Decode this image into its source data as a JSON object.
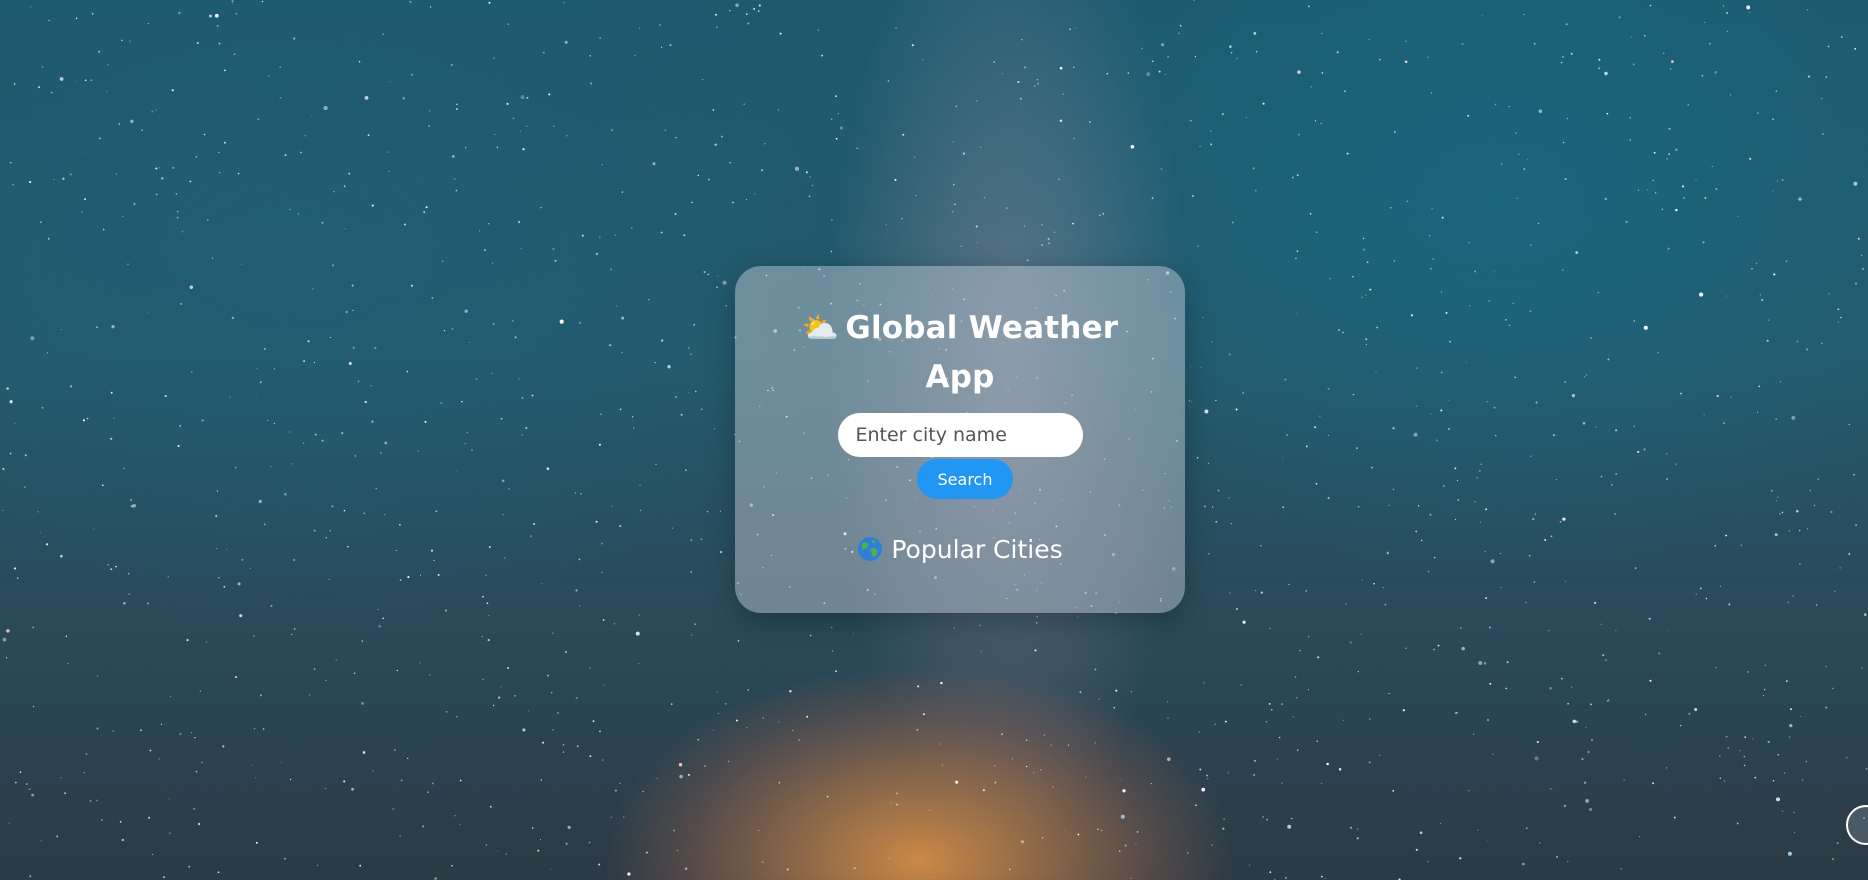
{
  "app": {
    "title": "Global Weather App",
    "title_icon": "cloud-sun-icon"
  },
  "search": {
    "placeholder": "Enter city name",
    "value": "",
    "button_label": "Search"
  },
  "popular": {
    "icon": "globe-icon",
    "label": "Popular Cities"
  },
  "colors": {
    "accent": "#2196f3",
    "card_background": "rgba(200,205,215,0.45)",
    "text": "#ffffff"
  }
}
